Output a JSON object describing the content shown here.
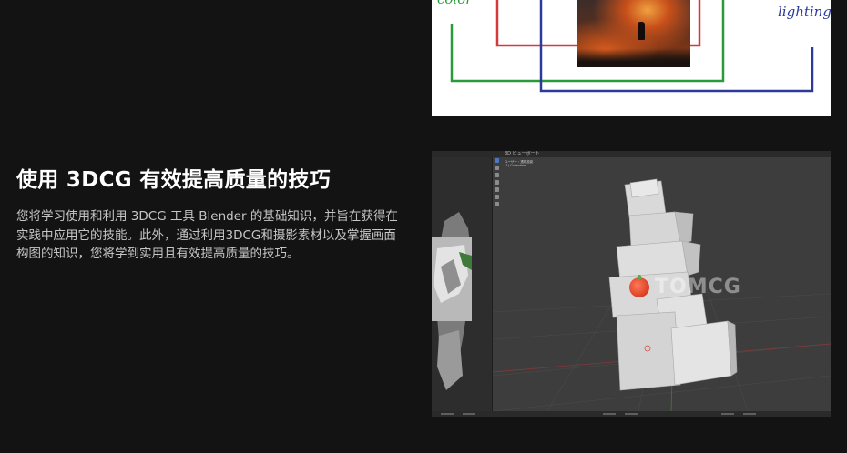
{
  "feature": {
    "title": "使用 3DCG 有效提高质量的技巧",
    "description_lines": [
      "您将学习使用和利用 3DCG 工具 Blender 的基础知识，并旨在获得在",
      "实践中应用它的技能。此外，通过利用3DCG和摄影素材以及掌握画面",
      "构图的知识，您将学到实用且有效提高质量的技巧。"
    ]
  },
  "whiteboard": {
    "note_left": "color",
    "note_right": "lighting",
    "colors": {
      "red": "#d33a3a",
      "green": "#2a9a3a",
      "blue": "#2c3a9a"
    }
  },
  "blender": {
    "viewport_header": "3D ビューポート",
    "info_lines": [
      "ユーザー・透視投影",
      "(1) Collection"
    ],
    "watermark": "TOMCG"
  }
}
